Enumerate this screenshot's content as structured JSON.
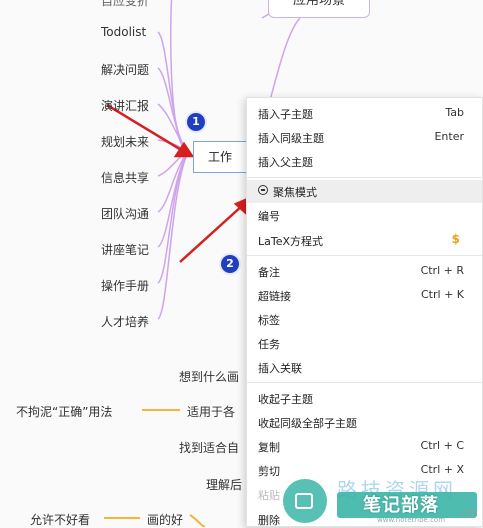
{
  "mindmap": {
    "top_node": "应用场景",
    "top_left_partial": "自应变折",
    "left_branches": [
      "Todolist",
      "解决问题",
      "演讲汇报",
      "规划未来",
      "信息共享",
      "团队沟通",
      "讲座笔记",
      "操作手册",
      "人才培养"
    ],
    "central_node": "工作",
    "lower_nodes": {
      "n1": "想到什么画",
      "n2a": "不拘泥“正确”用法",
      "n2b": "适用于各",
      "n3": "找到适合自",
      "n4": "理解后",
      "n5a": "允许不好看",
      "n5b": "画的好"
    }
  },
  "annotations": {
    "badge1": "1",
    "badge2": "2"
  },
  "context_menu": {
    "items": [
      {
        "label": "插入子主题",
        "shortcut": "Tab"
      },
      {
        "label": "插入同级主题",
        "shortcut": "Enter"
      },
      {
        "label": "插入父主题",
        "shortcut": ""
      },
      {
        "label": "聚焦模式",
        "shortcut": ""
      },
      {
        "label": "编号",
        "shortcut": ""
      },
      {
        "label": "LaTeX方程式",
        "shortcut": "$"
      },
      {
        "label": "备注",
        "shortcut": "Ctrl + R"
      },
      {
        "label": "超链接",
        "shortcut": "Ctrl + K"
      },
      {
        "label": "标签",
        "shortcut": ""
      },
      {
        "label": "任务",
        "shortcut": ""
      },
      {
        "label": "插入关联",
        "shortcut": ""
      },
      {
        "label": "收起子主题",
        "shortcut": ""
      },
      {
        "label": "收起同级全部子主题",
        "shortcut": ""
      },
      {
        "label": "复制",
        "shortcut": "Ctrl + C"
      },
      {
        "label": "剪切",
        "shortcut": "Ctrl + X"
      },
      {
        "label": "粘贴",
        "shortcut": ""
      },
      {
        "label": "删除",
        "shortcut": ""
      }
    ]
  },
  "watermark": {
    "big": "笔记部落",
    "blue": "路技资源网",
    "url": "www.notetribe.com",
    "partial": "cn"
  },
  "colors": {
    "branch": "#d0a4ec",
    "orange": "#f5b53a",
    "arrow": "#d62020",
    "badge": "#1e40c0",
    "accent": "#35b38a"
  }
}
